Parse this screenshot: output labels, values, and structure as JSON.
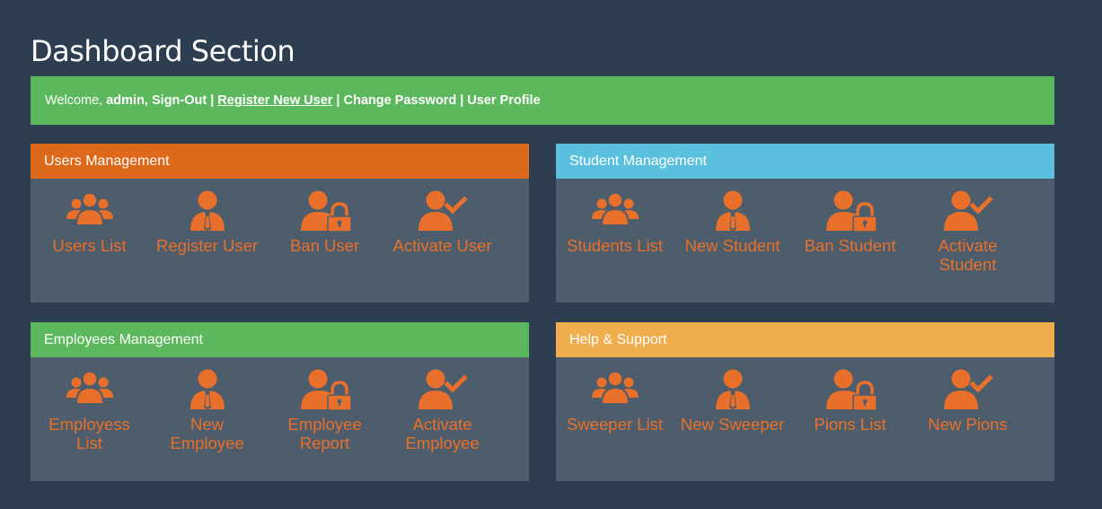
{
  "page": {
    "title": "Dashboard Section"
  },
  "welcome": {
    "greeting": "Welcome,",
    "user": "admin,",
    "sign_out": "Sign-Out",
    "register": "Register New User",
    "change_password": "Change Password",
    "profile": "User Profile",
    "separator": "|"
  },
  "colors": {
    "background": "#2c3e50",
    "panel_body": "#4e5d6c",
    "accent_orange": "#e8702a",
    "header_orange": "#df691a",
    "header_blue": "#5bc0de",
    "header_green": "#5cb85c",
    "header_amber": "#f0ad4e"
  },
  "panels": [
    {
      "title": "Users Management",
      "header_color": "#df691a",
      "items": [
        {
          "label": "Users List",
          "icon": "users-group-icon"
        },
        {
          "label": "Register User",
          "icon": "user-tie-icon"
        },
        {
          "label": "Ban User",
          "icon": "user-lock-icon"
        },
        {
          "label": "Activate User",
          "icon": "user-check-icon"
        }
      ]
    },
    {
      "title": "Student Management",
      "header_color": "#5bc0de",
      "items": [
        {
          "label": "Students List",
          "icon": "users-group-icon"
        },
        {
          "label": "New Student",
          "icon": "user-tie-icon"
        },
        {
          "label": "Ban Student",
          "icon": "user-lock-icon"
        },
        {
          "label": "Activate Student",
          "icon": "user-check-icon"
        }
      ]
    },
    {
      "title": "Employees Management",
      "header_color": "#5cb85c",
      "items": [
        {
          "label": "Employess List",
          "icon": "users-group-icon"
        },
        {
          "label": "New Employee",
          "icon": "user-tie-icon"
        },
        {
          "label": "Employee Report",
          "icon": "user-lock-icon"
        },
        {
          "label": "Activate Employee",
          "icon": "user-check-icon"
        }
      ]
    },
    {
      "title": "Help & Support",
      "header_color": "#f0ad4e",
      "items": [
        {
          "label": "Sweeper List",
          "icon": "users-group-icon"
        },
        {
          "label": "New Sweeper",
          "icon": "user-tie-icon"
        },
        {
          "label": "Pions List",
          "icon": "user-lock-icon"
        },
        {
          "label": "New Pions",
          "icon": "user-check-icon"
        }
      ]
    }
  ]
}
